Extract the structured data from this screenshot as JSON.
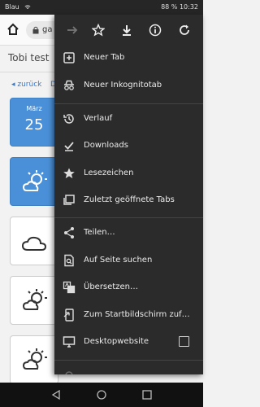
{
  "status": {
    "carrier": "Blau",
    "battery": "88 %",
    "time": "10:32"
  },
  "address": {
    "url_fragment": "ga"
  },
  "page": {
    "title": "Tobi test",
    "back_link": "◂ zurück",
    "separator": "D",
    "cards": [
      {
        "month": "März",
        "day": "25"
      }
    ]
  },
  "menu": {
    "items": [
      {
        "label": "Neuer Tab",
        "icon": "new-tab-icon"
      },
      {
        "label": "Neuer Inkognitotab",
        "icon": "incognito-icon"
      },
      {
        "label": "Verlauf",
        "icon": "history-icon"
      },
      {
        "label": "Downloads",
        "icon": "downloads-icon"
      },
      {
        "label": "Lesezeichen",
        "icon": "bookmarks-icon"
      },
      {
        "label": "Zuletzt geöffnete Tabs",
        "icon": "recent-tabs-icon"
      },
      {
        "label": "Teilen…",
        "icon": "share-icon"
      },
      {
        "label": "Auf Seite suchen",
        "icon": "find-in-page-icon"
      },
      {
        "label": "Übersetzen…",
        "icon": "translate-icon"
      },
      {
        "label": "Zum Startbildschirm zuf…",
        "icon": "add-to-home-icon"
      },
      {
        "label": "Desktopwebsite",
        "icon": "desktop-icon"
      }
    ]
  }
}
